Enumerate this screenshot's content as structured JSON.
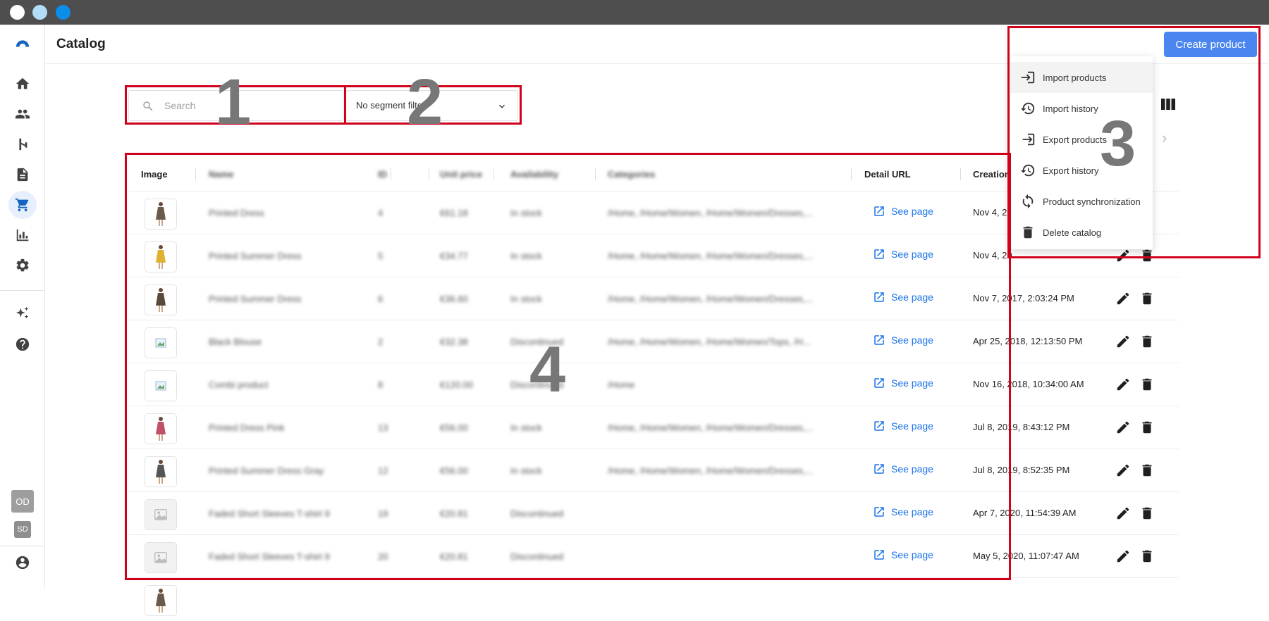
{
  "window": {
    "dots": [
      "#ffffff",
      "#b3dcf7",
      "#0b8ee8"
    ]
  },
  "header": {
    "title": "Catalog",
    "more_label": "•••",
    "create_button": "Create product"
  },
  "sidebar": {
    "items": [
      "home-icon",
      "audience-icon",
      "scenarios-icon",
      "templates-icon",
      "catalog-icon",
      "statistics-icon",
      "settings-icon"
    ],
    "active": "catalog-icon",
    "account_badge_1": "OD",
    "account_badge_2": "SD"
  },
  "filters": {
    "search_placeholder": "Search",
    "segment_value": "No segment filter"
  },
  "table": {
    "headers": {
      "image": "Image",
      "name": "Name",
      "id": "ID",
      "unit_price": "Unit price",
      "availability": "Availability",
      "categories": "Categories",
      "detail_url": "Detail URL",
      "creation": "Creation"
    },
    "see_page_label": "See page",
    "rows": [
      {
        "name": "Printed Dress",
        "id": "4",
        "price": "€61.18",
        "availability": "In stock",
        "categories": "/Home, /Home/Women, /Home/Women/Dresses,...",
        "created": "Nov 4, 20",
        "thumb": "photo"
      },
      {
        "name": "Printed Summer Dress",
        "id": "5",
        "price": "€34.77",
        "availability": "In stock",
        "categories": "/Home, /Home/Women, /Home/Women/Dresses,...",
        "created": "Nov 4, 20",
        "thumb": "photo"
      },
      {
        "name": "Printed Summer Dress",
        "id": "6",
        "price": "€36.60",
        "availability": "In stock",
        "categories": "/Home, /Home/Women, /Home/Women/Dresses,...",
        "created": "Nov 7, 2017, 2:03:24 PM",
        "thumb": "photo"
      },
      {
        "name": "Black Blouse",
        "id": "2",
        "price": "€32.38",
        "availability": "Discontinued",
        "categories": "/Home, /Home/Women, /Home/Women/Tops, /H...",
        "created": "Apr 25, 2018, 12:13:50 PM",
        "thumb": "broken"
      },
      {
        "name": "Combi product",
        "id": "8",
        "price": "€120.00",
        "availability": "Discontinued",
        "categories": "/Home",
        "created": "Nov 16, 2018, 10:34:00 AM",
        "thumb": "broken"
      },
      {
        "name": "Printed Dress Pink",
        "id": "13",
        "price": "€56.00",
        "availability": "In stock",
        "categories": "/Home, /Home/Women, /Home/Women/Dresses,...",
        "created": "Jul 8, 2019, 8:43:12 PM",
        "thumb": "photo"
      },
      {
        "name": "Printed Summer Dress Gray",
        "id": "12",
        "price": "€56.00",
        "availability": "In stock",
        "categories": "/Home, /Home/Women, /Home/Women/Dresses,...",
        "created": "Jul 8, 2019, 8:52:35 PM",
        "thumb": "photo"
      },
      {
        "name": "Faded Short Sleeves T-shirt 9",
        "id": "19",
        "price": "€20.81",
        "availability": "Discontinued",
        "categories": "",
        "created": "Apr 7, 2020, 11:54:39 AM",
        "thumb": "placeholder"
      },
      {
        "name": "Faded Short Sleeves T-shirt 9",
        "id": "20",
        "price": "€20.81",
        "availability": "Discontinued",
        "categories": "",
        "created": "May 5, 2020, 11:07:47 AM",
        "thumb": "placeholder"
      }
    ]
  },
  "menu": {
    "items": [
      {
        "label": "Import products",
        "icon": "import-icon"
      },
      {
        "label": "Import history",
        "icon": "history-icon"
      },
      {
        "label": "Export products",
        "icon": "export-icon"
      },
      {
        "label": "Export history",
        "icon": "history-icon"
      },
      {
        "label": "Product synchronization",
        "icon": "sync-icon"
      },
      {
        "label": "Delete catalog",
        "icon": "trash-icon"
      }
    ]
  },
  "annotations": {
    "box_1": "1",
    "box_2": "2",
    "box_3": "3",
    "box_4": "4",
    "color": "#d0021b"
  }
}
